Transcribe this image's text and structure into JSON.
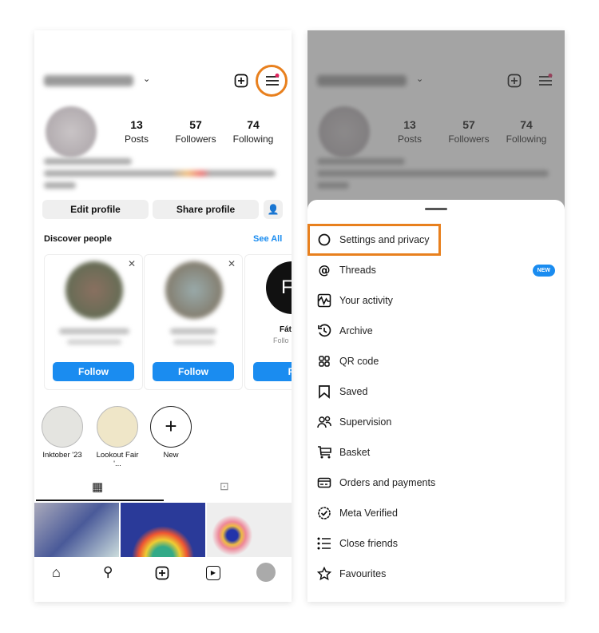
{
  "profile": {
    "posts": "13",
    "posts_label": "Posts",
    "followers": "57",
    "followers_label": "Followers",
    "following": "74",
    "following_label": "Following",
    "edit_profile": "Edit profile",
    "share_profile": "Share profile",
    "discover": "Discover people",
    "see_all": "See All",
    "cards": [
      {
        "follow": "Follow"
      },
      {
        "follow": "Follow"
      },
      {
        "name": "Fát",
        "sub": "Follo",
        "follow": "Fo",
        "avatar_text": "Fa"
      }
    ],
    "highlights": [
      {
        "label": "Inktober '23"
      },
      {
        "label": "Lookout Fair '..."
      },
      {
        "label": "New"
      }
    ]
  },
  "menu": {
    "items": [
      {
        "label": "Settings and privacy",
        "icon": "settings-icon"
      },
      {
        "label": "Threads",
        "icon": "threads-icon",
        "badge": "NEW"
      },
      {
        "label": "Your activity",
        "icon": "activity-icon"
      },
      {
        "label": "Archive",
        "icon": "archive-icon"
      },
      {
        "label": "QR code",
        "icon": "qr-code-icon"
      },
      {
        "label": "Saved",
        "icon": "bookmark-icon"
      },
      {
        "label": "Supervision",
        "icon": "supervision-icon"
      },
      {
        "label": "Basket",
        "icon": "cart-icon"
      },
      {
        "label": "Orders and payments",
        "icon": "card-icon"
      },
      {
        "label": "Meta Verified",
        "icon": "verified-icon"
      },
      {
        "label": "Close friends",
        "icon": "close-friends-icon"
      },
      {
        "label": "Favourites",
        "icon": "star-icon"
      }
    ]
  },
  "colors": {
    "accent": "#1a8cf0",
    "highlight": "#e8801e",
    "notification": "#e0245e"
  }
}
